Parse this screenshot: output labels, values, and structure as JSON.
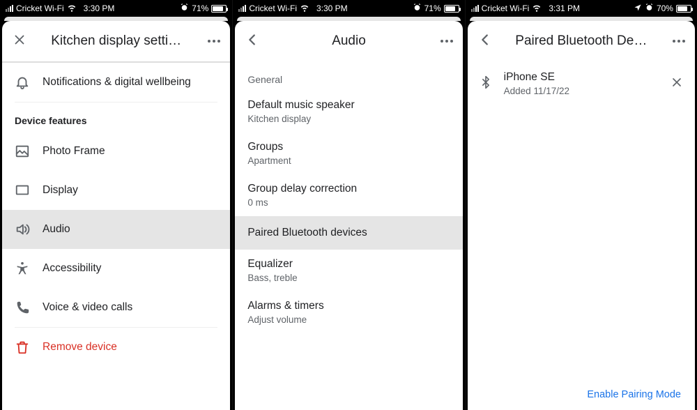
{
  "status": {
    "carrier": "Cricket Wi-Fi",
    "time1": "3:30 PM",
    "time2": "3:30 PM",
    "time3": "3:31 PM",
    "battery1": "71%",
    "battery2": "71%",
    "battery3": "70%"
  },
  "screen1": {
    "title": "Kitchen display setti…",
    "rows": {
      "notifications": "Notifications & digital wellbeing",
      "section": "Device features",
      "photo_frame": "Photo Frame",
      "display": "Display",
      "audio": "Audio",
      "accessibility": "Accessibility",
      "voice_video": "Voice & video calls",
      "remove": "Remove device"
    }
  },
  "screen2": {
    "title": "Audio",
    "section": "General",
    "rows": {
      "default_speaker": {
        "label": "Default music speaker",
        "sub": "Kitchen display"
      },
      "groups": {
        "label": "Groups",
        "sub": "Apartment"
      },
      "delay": {
        "label": "Group delay correction",
        "sub": "0 ms"
      },
      "paired": {
        "label": "Paired Bluetooth devices"
      },
      "equalizer": {
        "label": "Equalizer",
        "sub": "Bass, treble"
      },
      "alarms": {
        "label": "Alarms & timers",
        "sub": "Adjust volume"
      }
    }
  },
  "screen3": {
    "title": "Paired Bluetooth De…",
    "device": {
      "name": "iPhone SE",
      "added": "Added 11/17/22"
    },
    "footer": "Enable Pairing Mode"
  }
}
